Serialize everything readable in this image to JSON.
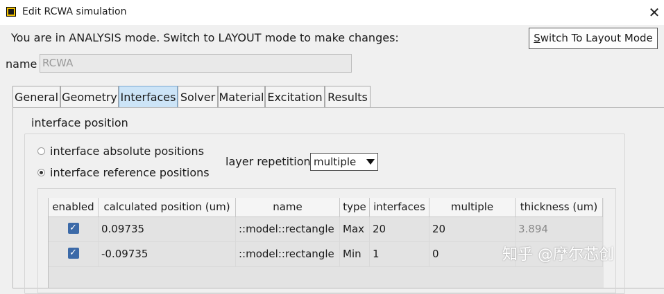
{
  "window": {
    "title": "Edit RCWA simulation",
    "close_glyph": "✕"
  },
  "mode_message": "You are in ANALYSIS mode.  Switch to LAYOUT mode to make changes:",
  "switch_button": {
    "label_prefix": "",
    "label_accel": "S",
    "label_rest": "witch To Layout Mode"
  },
  "name_field": {
    "label": "name",
    "value": "RCWA"
  },
  "tabs": [
    {
      "label": "General",
      "active": false
    },
    {
      "label": "Geometry",
      "active": false
    },
    {
      "label": "Interfaces",
      "active": true
    },
    {
      "label": "Solver",
      "active": false
    },
    {
      "label": "Material",
      "active": false
    },
    {
      "label": "Excitation",
      "active": false
    },
    {
      "label": "Results",
      "active": false
    }
  ],
  "interface_section": {
    "title": "interface position",
    "radio_absolute": {
      "label": "interface absolute positions",
      "checked": false
    },
    "radio_reference": {
      "label": "interface reference positions",
      "checked": true
    },
    "layer_repetition": {
      "label": "layer repetition",
      "value": "multiple"
    }
  },
  "table": {
    "columns": [
      "enabled",
      "calculated position (um)",
      "name",
      "type",
      "interfaces",
      "multiple",
      "thickness (um)"
    ],
    "rows": [
      {
        "enabled": true,
        "position": "0.09735",
        "name": "::model::rectangle",
        "type": "Max",
        "interfaces": "20",
        "multiple": "20",
        "thickness": "3.894"
      },
      {
        "enabled": true,
        "position": "-0.09735",
        "name": "::model::rectangle",
        "type": "Min",
        "interfaces": "1",
        "multiple": "0",
        "thickness": ""
      }
    ]
  },
  "watermark": "知乎 @摩尔芯创",
  "colors": {
    "active_tab": "#cce4f7",
    "checkbox": "#3c6aa8",
    "icon_yellow": "#f2c200"
  },
  "icons": {
    "app": "rcwa-app-icon",
    "close": "close-icon",
    "dropdown": "triangle-down-icon",
    "check": "checkmark-icon"
  }
}
